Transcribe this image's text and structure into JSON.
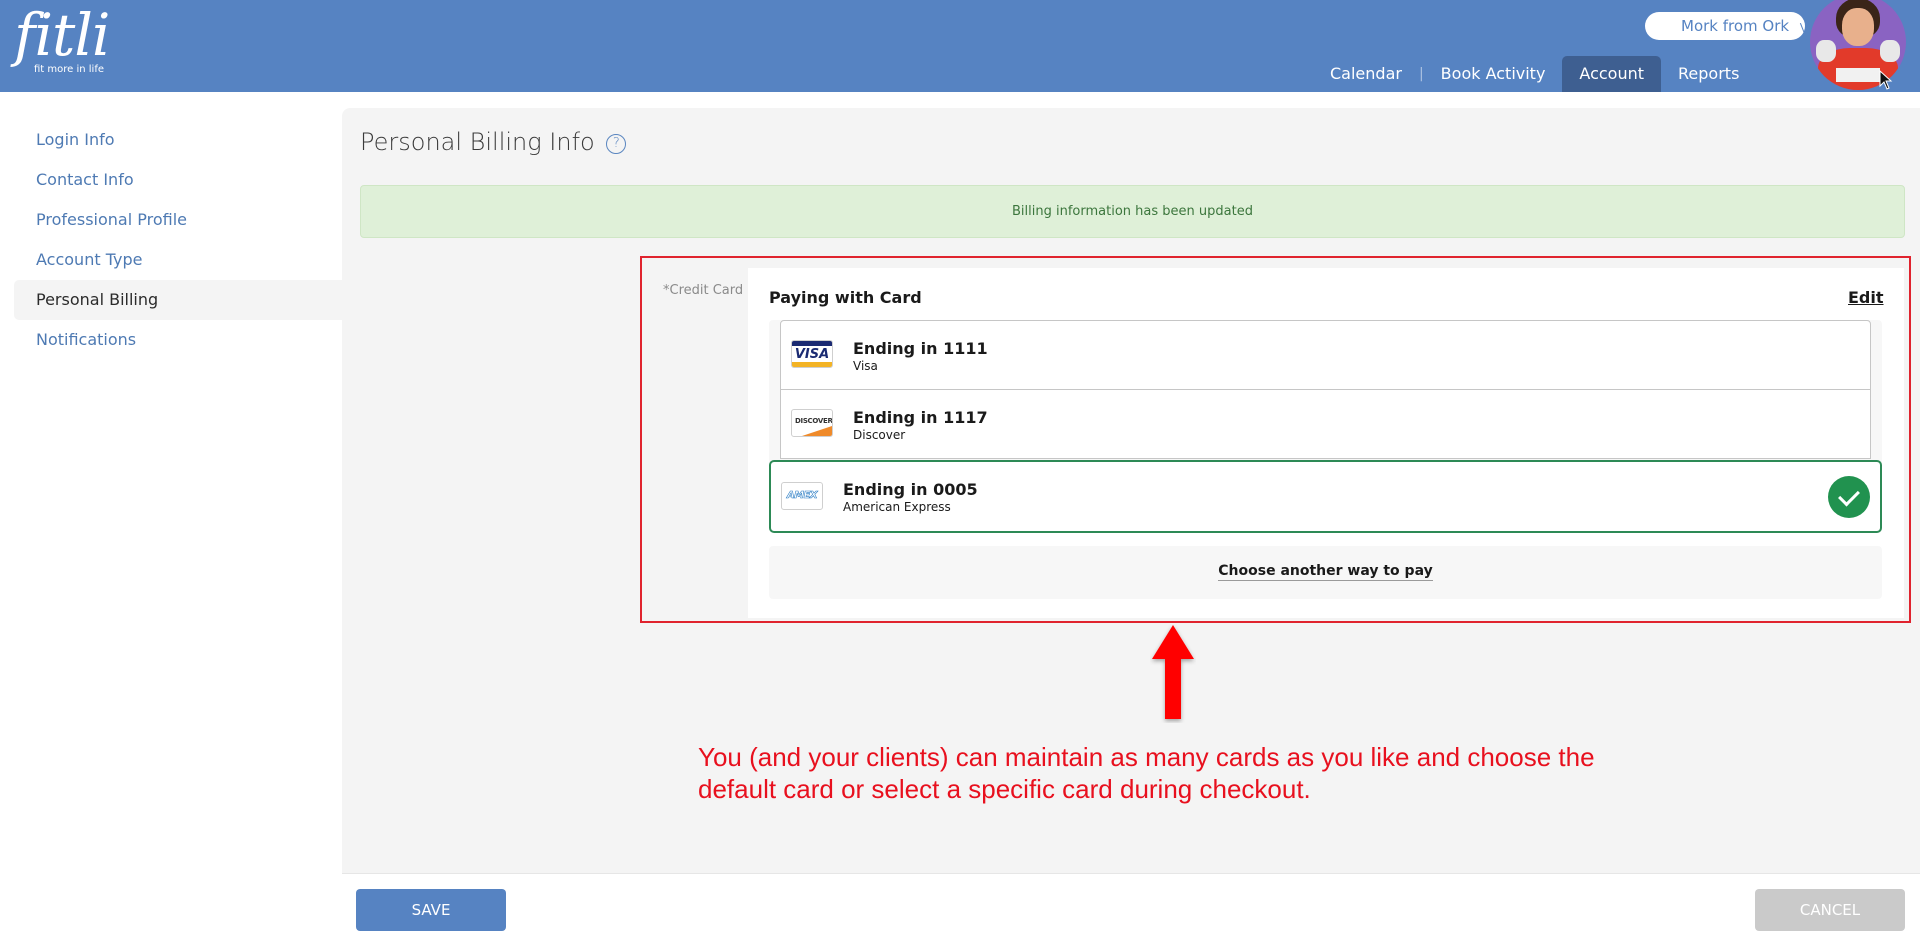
{
  "header": {
    "logo": {
      "word": "fitli",
      "tagline": "fit more in life"
    },
    "user_menu": {
      "name": "Mork from Ork",
      "chevron": "double-chevron-down"
    },
    "nav": [
      {
        "label": "Calendar",
        "active": false
      },
      {
        "label": "Book Activity",
        "active": false
      },
      {
        "label": "Account",
        "active": true
      },
      {
        "label": "Reports",
        "active": false
      }
    ],
    "nav_separator": "|"
  },
  "sidebar": {
    "items": [
      {
        "label": "Login Info",
        "active": false
      },
      {
        "label": "Contact Info",
        "active": false
      },
      {
        "label": "Professional Profile",
        "active": false
      },
      {
        "label": "Account Type",
        "active": false
      },
      {
        "label": "Personal Billing",
        "active": true
      },
      {
        "label": "Notifications",
        "active": false
      }
    ]
  },
  "main": {
    "title": "Personal Billing Info",
    "help_icon": "?",
    "alert": "Billing information has been updated",
    "credit_card_label": "*Credit Card",
    "payment": {
      "title": "Paying with Card",
      "edit_label": "Edit",
      "cards": [
        {
          "brand_logo": "VISA",
          "title": "Ending in 1111",
          "brand": "Visa",
          "selected": false
        },
        {
          "brand_logo": "DISCOVER",
          "title": "Ending in 1117",
          "brand": "Discover",
          "selected": false
        },
        {
          "brand_logo": "AMEX",
          "title": "Ending in 0005",
          "brand": "American Express",
          "selected": true
        }
      ],
      "another_way_label": "Choose another way to pay"
    },
    "annotation": "You (and your clients) can maintain as many cards as you like and choose the default card or select a specific card during checkout."
  },
  "footer": {
    "save_label": "SAVE",
    "cancel_label": "CANCEL"
  },
  "colors": {
    "brand": "#5683c2",
    "nav_active": "#3e5f91",
    "success_bg": "#dff0d8",
    "success_text": "#3c763d",
    "selected_border": "#2d8a56",
    "check": "#21924f",
    "annotation_red": "#e8101e"
  }
}
